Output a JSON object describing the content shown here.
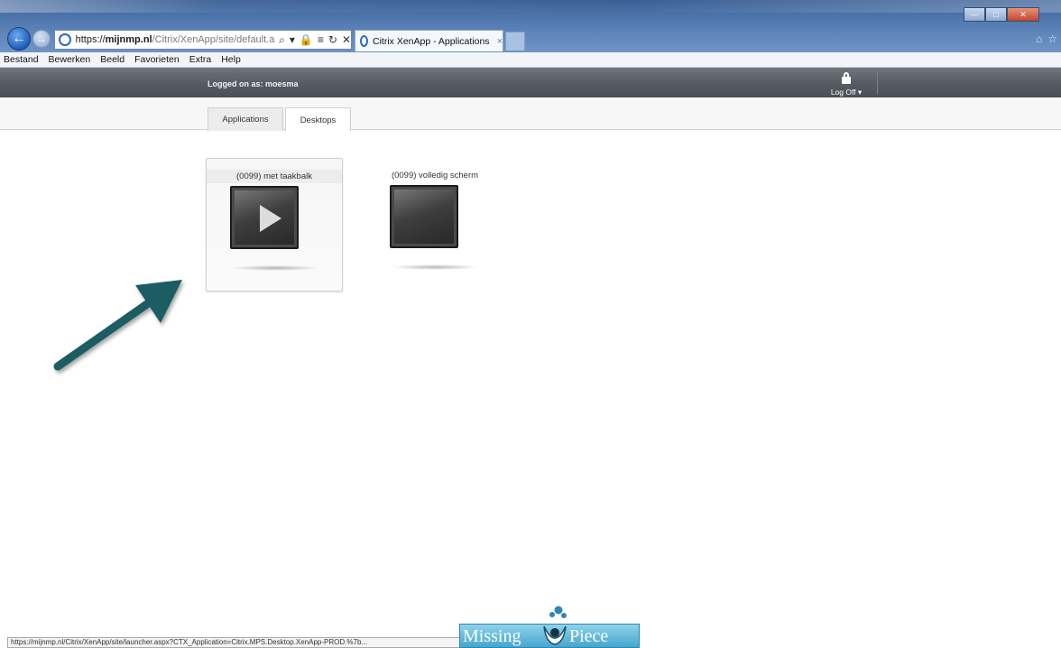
{
  "browser": {
    "address": {
      "scheme": "https://",
      "host": "mijnmp.nl",
      "path": "/Citrix/XenApp/site/default.asp"
    },
    "tab_title": "Citrix XenApp - Applications",
    "tab_close": "×",
    "menu": [
      "Bestand",
      "Bewerken",
      "Beeld",
      "Favorieten",
      "Extra",
      "Help"
    ],
    "status_url": "https://mijnmp.nl/Citrix/XenApp/site/launcher.aspx?CTX_Application=Citrix.MPS.Desktop.XenApp-PROD.%7b..."
  },
  "header": {
    "logged_on": "Logged on as: moesma",
    "logoff_label": "Log Off ▾"
  },
  "tabs": [
    {
      "label": "Applications",
      "active": false
    },
    {
      "label": "Desktops",
      "active": true
    }
  ],
  "desktops": [
    {
      "name": "(0099) met taakbalk",
      "selected": true,
      "icon": "play-icon"
    },
    {
      "name": "(0099) volledig scherm",
      "selected": false,
      "icon": "monitor-icon"
    }
  ],
  "watermark": {
    "left": "Missing",
    "right": "Piece"
  },
  "colors": {
    "header_bg": "#545b63",
    "arrow": "#1f5d63",
    "logo_banner": "#46a6cf"
  }
}
